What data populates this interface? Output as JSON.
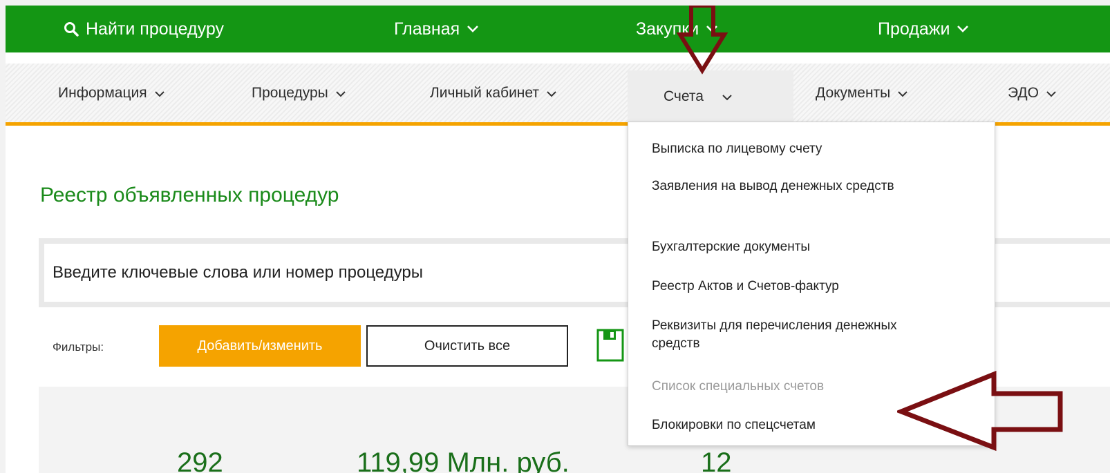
{
  "topbar": {
    "search_label": "Найти процедуру",
    "items": [
      {
        "label": "Главная"
      },
      {
        "label": "Закупки"
      },
      {
        "label": "Продажи"
      }
    ]
  },
  "subnav": {
    "items": [
      {
        "label": "Информация"
      },
      {
        "label": "Процедуры"
      },
      {
        "label": "Личный кабинет"
      },
      {
        "label": "Счета"
      },
      {
        "label": "Документы"
      },
      {
        "label": "ЭДО"
      }
    ]
  },
  "page": {
    "title": "Реестр объявленных процедур",
    "search_placeholder": "Введите ключевые слова или номер процедуры",
    "filters_label": "Фильтры:",
    "add_filter_label": "Добавить/изменить",
    "clear_all_label": "Очистить все"
  },
  "stats": [
    "292",
    "119,99 Млн. руб.",
    "12"
  ],
  "dropdown": {
    "options": [
      {
        "label": "Выписка по лицевому счету",
        "enabled": true
      },
      {
        "label": "Заявления на вывод денежных средств",
        "enabled": true
      },
      {
        "label": "Бухгалтерские документы",
        "enabled": true
      },
      {
        "label": "Реестр Актов и Счетов-фактур",
        "enabled": true
      },
      {
        "label": "Реквизиты для перечисления денежных средств",
        "enabled": true
      },
      {
        "label": "Список специальных счетов",
        "enabled": false
      },
      {
        "label": "Блокировки по спецсчетам",
        "enabled": true
      }
    ]
  },
  "colors": {
    "topbar": "#149614",
    "accent": "#f5a300",
    "title": "#1a8a1a",
    "annotation_arrow": "#7a0f12"
  }
}
